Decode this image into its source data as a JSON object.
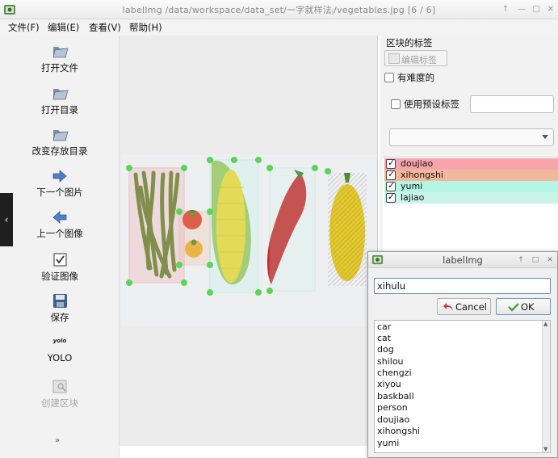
{
  "window": {
    "title": "labelImg /data/workspace/data_set/一字就样法ⱼ/vegetables.jpg [6 / 6]"
  },
  "menu": [
    "文件(F)",
    "编辑(E)",
    "查看(V)",
    "帮助(H)"
  ],
  "toolbar": [
    {
      "label": "打开文件",
      "icon": "folder-icon"
    },
    {
      "label": "打开目录",
      "icon": "folder-icon"
    },
    {
      "label": "改变存放目录",
      "icon": "folder-icon"
    },
    {
      "label": "下一个图片",
      "icon": "arrow-right-icon"
    },
    {
      "label": "上一个图像",
      "icon": "arrow-left-icon"
    },
    {
      "label": "验证图像",
      "icon": "verify-icon"
    },
    {
      "label": "保存",
      "icon": "save-icon"
    },
    {
      "label": "YOLO",
      "icon": "yolo-icon",
      "icon_text": "yolo"
    },
    {
      "label": "创建区块",
      "icon": "create-box-icon",
      "disabled": true
    }
  ],
  "dock": {
    "title": "区块的标签",
    "edit_button": "编辑标签",
    "difficult_label": "有难度的",
    "use_preset_label": "使用预设标签",
    "preset_value": "",
    "combo_value": "",
    "labels": [
      {
        "name": "doujiao",
        "color": "#f7a4ad"
      },
      {
        "name": "xihongshi",
        "color": "#f1b89c"
      },
      {
        "name": "yumi",
        "color": "#b6f4e4"
      },
      {
        "name": "lajiao",
        "color": "#c9f4ea"
      }
    ]
  },
  "dialog": {
    "title": "labelImg",
    "input_value": "xihulu",
    "cancel_label": "Cancel",
    "ok_label": "OK",
    "items": [
      "car",
      "cat",
      "dog",
      "shilou",
      "chengzi",
      "xiyou",
      "baskball",
      "person",
      "doujiao",
      "xihongshi",
      "yumi"
    ]
  }
}
